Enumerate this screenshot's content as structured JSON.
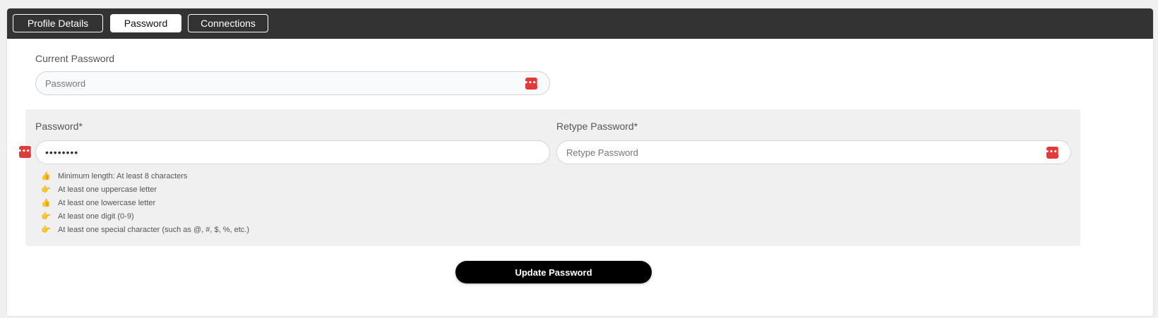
{
  "tabs": [
    {
      "label": "Profile Details",
      "active": false
    },
    {
      "label": "Password",
      "active": true
    },
    {
      "label": "Connections",
      "active": false
    }
  ],
  "current_password": {
    "label": "Current Password",
    "placeholder": "Password",
    "value": ""
  },
  "new_password": {
    "label": "Password*",
    "value": "••••••••",
    "placeholder": ""
  },
  "retype_password": {
    "label": "Retype Password*",
    "placeholder": "Retype Password",
    "value": ""
  },
  "requirements": [
    {
      "icon": "thumbs-up",
      "text": "Minimum length: At least 8 characters"
    },
    {
      "icon": "pointing-right",
      "text": "At least one uppercase letter"
    },
    {
      "icon": "thumbs-up",
      "text": "At least one lowercase letter"
    },
    {
      "icon": "pointing-right",
      "text": "At least one digit (0-9)"
    },
    {
      "icon": "pointing-right",
      "text": "At least one special character (such as @, #, $, %, etc.)"
    }
  ],
  "update_button": {
    "label": "Update Password"
  },
  "colors": {
    "tabbar_bg": "#333333",
    "password_manager_icon": "#e03b3b",
    "primary_button": "#000000",
    "panel_bg": "#f0f0f0"
  }
}
